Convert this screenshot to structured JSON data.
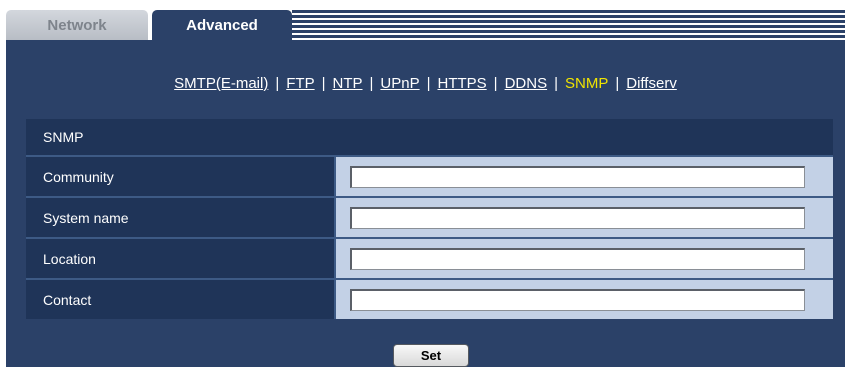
{
  "tabs": [
    {
      "label": "Network",
      "active": false
    },
    {
      "label": "Advanced",
      "active": true
    }
  ],
  "sub_nav": {
    "items": [
      "SMTP(E-mail)",
      "FTP",
      "NTP",
      "UPnP",
      "HTTPS",
      "DDNS",
      "SNMP",
      "Diffserv"
    ],
    "active": "SNMP",
    "separator": "|"
  },
  "section": {
    "title": "SNMP"
  },
  "fields": [
    {
      "label": "Community",
      "value": ""
    },
    {
      "label": "System name",
      "value": ""
    },
    {
      "label": "Location",
      "value": ""
    },
    {
      "label": "Contact",
      "value": ""
    }
  ],
  "set_button": {
    "label": "Set"
  },
  "colors": {
    "panel_bg": "#2b4168",
    "label_bg": "#1f3458",
    "value_bg": "#c3d1e6",
    "active_link": "#f0e400"
  }
}
